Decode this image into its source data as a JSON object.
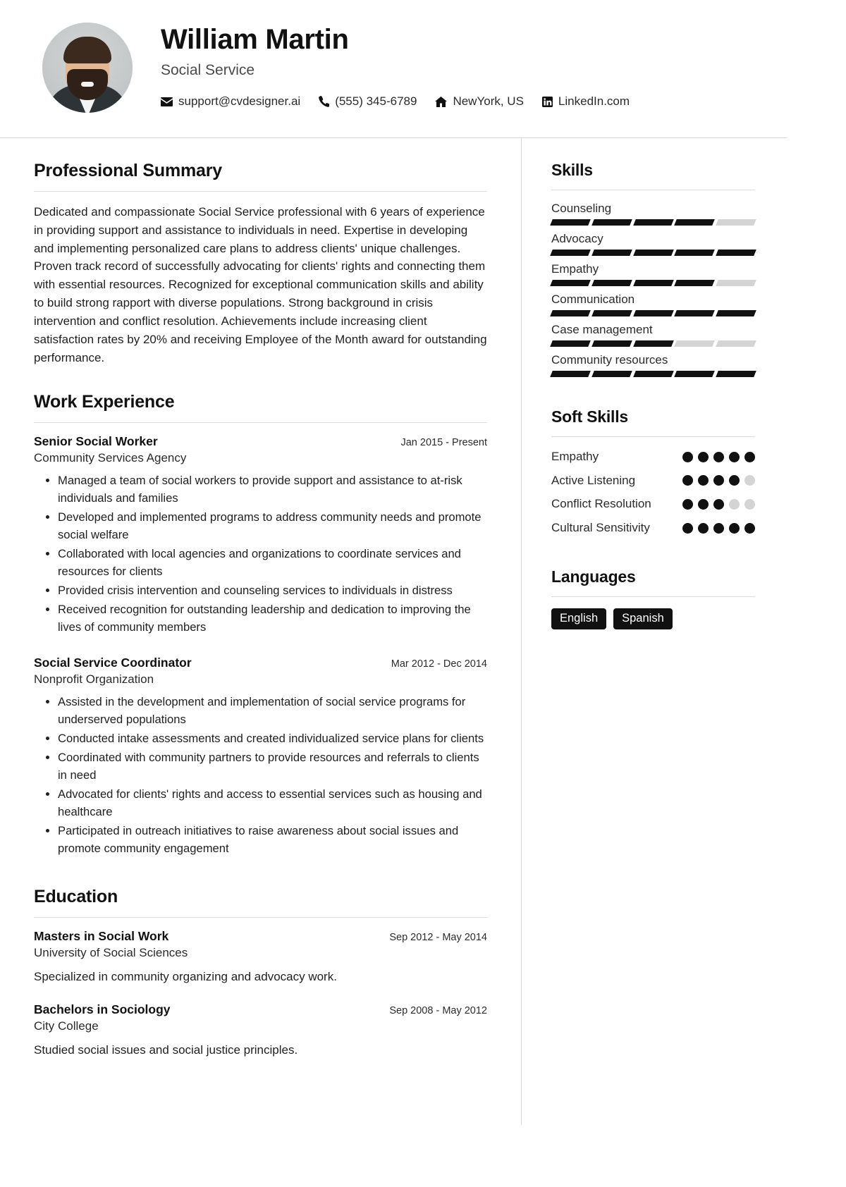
{
  "header": {
    "name": "William Martin",
    "job_title": "Social Service",
    "avatar_alt": "profile-photo",
    "contacts": [
      {
        "icon": "email-icon",
        "value": "support@cvdesigner.ai"
      },
      {
        "icon": "phone-icon",
        "value": "(555) 345-6789"
      },
      {
        "icon": "home-icon",
        "value": "NewYork, US"
      },
      {
        "icon": "linkedin-icon",
        "value": "LinkedIn.com"
      }
    ]
  },
  "main": {
    "summary": {
      "title": "Professional Summary",
      "text": "Dedicated and compassionate Social Service professional with 6 years of experience in providing support and assistance to individuals in need. Expertise in developing and implementing personalized care plans to address clients' unique challenges. Proven track record of successfully advocating for clients' rights and connecting them with essential resources. Recognized for exceptional communication skills and ability to build strong rapport with diverse populations. Strong background in crisis intervention and conflict resolution. Achievements include increasing client satisfaction rates by 20% and receiving Employee of the Month award for outstanding performance."
    },
    "experience": {
      "title": "Work Experience",
      "jobs": [
        {
          "role": "Senior Social Worker",
          "date": "Jan 2015 - Present",
          "org": "Community Services Agency",
          "bullets": [
            "Managed a team of social workers to provide support and assistance to at-risk individuals and families",
            "Developed and implemented programs to address community needs and promote social welfare",
            "Collaborated with local agencies and organizations to coordinate services and resources for clients",
            "Provided crisis intervention and counseling services to individuals in distress",
            "Received recognition for outstanding leadership and dedication to improving the lives of community members"
          ]
        },
        {
          "role": "Social Service Coordinator",
          "date": "Mar 2012 - Dec 2014",
          "org": "Nonprofit Organization",
          "bullets": [
            "Assisted in the development and implementation of social service programs for underserved populations",
            "Conducted intake assessments and created individualized service plans for clients",
            "Coordinated with community partners to provide resources and referrals to clients in need",
            "Advocated for clients' rights and access to essential services such as housing and healthcare",
            "Participated in outreach initiatives to raise awareness about social issues and promote community engagement"
          ]
        }
      ]
    },
    "education": {
      "title": "Education",
      "items": [
        {
          "degree": "Masters in Social Work",
          "date": "Sep 2012 - May 2014",
          "school": "University of Social Sciences",
          "description": "Specialized in community organizing and advocacy work."
        },
        {
          "degree": "Bachelors in Sociology",
          "date": "Sep 2008 - May 2012",
          "school": "City College",
          "description": "Studied social issues and social justice principles."
        }
      ]
    }
  },
  "sidebar": {
    "skills": {
      "title": "Skills",
      "max": 5,
      "items": [
        {
          "label": "Counseling",
          "level": 4
        },
        {
          "label": "Advocacy",
          "level": 5
        },
        {
          "label": "Empathy",
          "level": 4
        },
        {
          "label": "Communication",
          "level": 5
        },
        {
          "label": "Case management",
          "level": 3
        },
        {
          "label": "Community resources",
          "level": 5
        }
      ]
    },
    "soft_skills": {
      "title": "Soft Skills",
      "max": 5,
      "items": [
        {
          "label": "Empathy",
          "level": 5
        },
        {
          "label": "Active Listening",
          "level": 4
        },
        {
          "label": "Conflict Resolution",
          "level": 3
        },
        {
          "label": "Cultural Sensitivity",
          "level": 5
        }
      ]
    },
    "languages": {
      "title": "Languages",
      "items": [
        "English",
        "Spanish"
      ]
    }
  },
  "colors": {
    "accent": "#111111",
    "muted": "#d4d4d4",
    "rule": "#dcdcdc",
    "text": "#1f1f1f"
  }
}
